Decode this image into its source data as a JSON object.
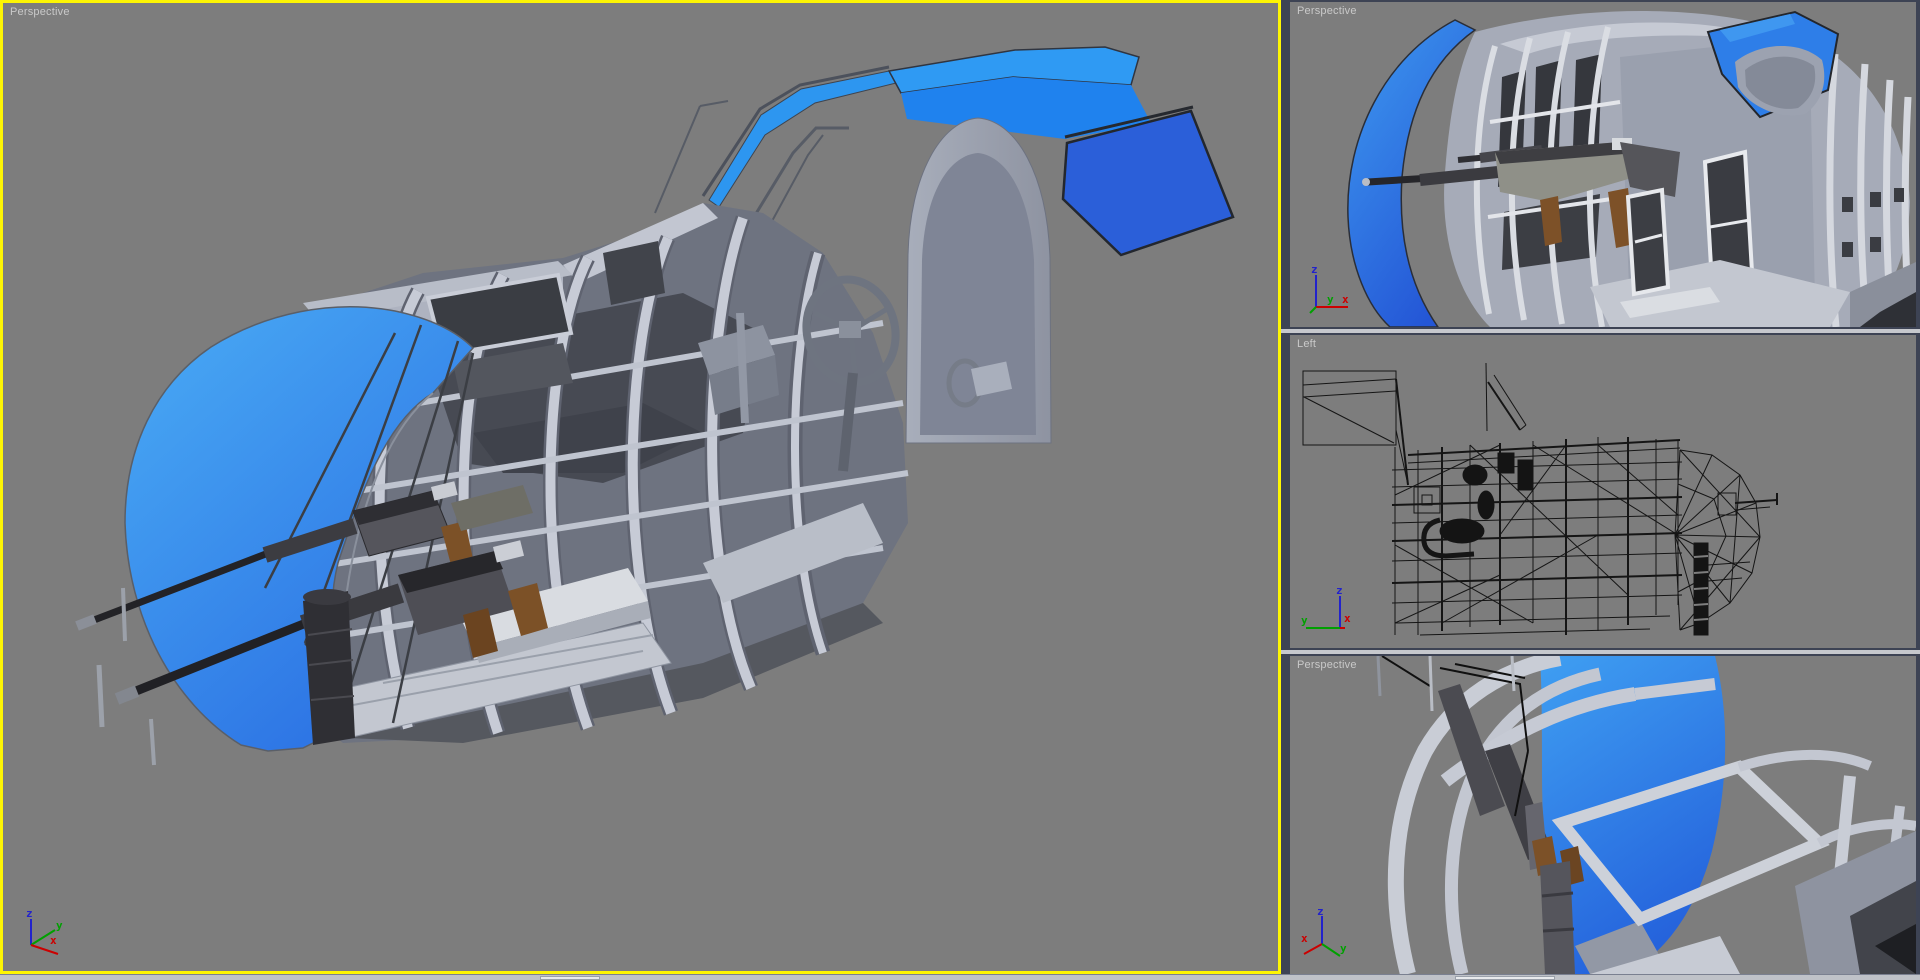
{
  "viewports": {
    "main": {
      "label": "Perspective",
      "active": true
    },
    "top_right": {
      "label": "Perspective"
    },
    "middle_right": {
      "label": "Left"
    },
    "bottom_right": {
      "label": "Perspective"
    }
  },
  "axis_labels": {
    "x": "x",
    "y": "y",
    "z": "z"
  },
  "colors": {
    "active_viewport_border": "#fdf503",
    "viewport_background": "#7d7d7d",
    "panel_separator": "#3d4354",
    "splitter_bar": "#c6c8cd",
    "label_text": "#c9c9c9",
    "canopy_blue_light": "#3fa3f4",
    "canopy_blue_mid": "#1f82ee",
    "canopy_blue_deep": "#2b5fd9",
    "nose_blue_top": "#4aacf5",
    "nose_blue_bottom": "#2b70e3",
    "frame_gray_light": "#c7cbd6",
    "frame_gray_mid": "#9ca2b0",
    "frame_gray_dark": "#474a53",
    "gun_black": "#232327",
    "gun_gray": "#55555c",
    "grip_brown": "#7c5127",
    "axis_x_color": "#cc0000",
    "axis_y_color": "#00a000",
    "axis_z_color": "#2222cc",
    "wireframe": "#151515"
  }
}
